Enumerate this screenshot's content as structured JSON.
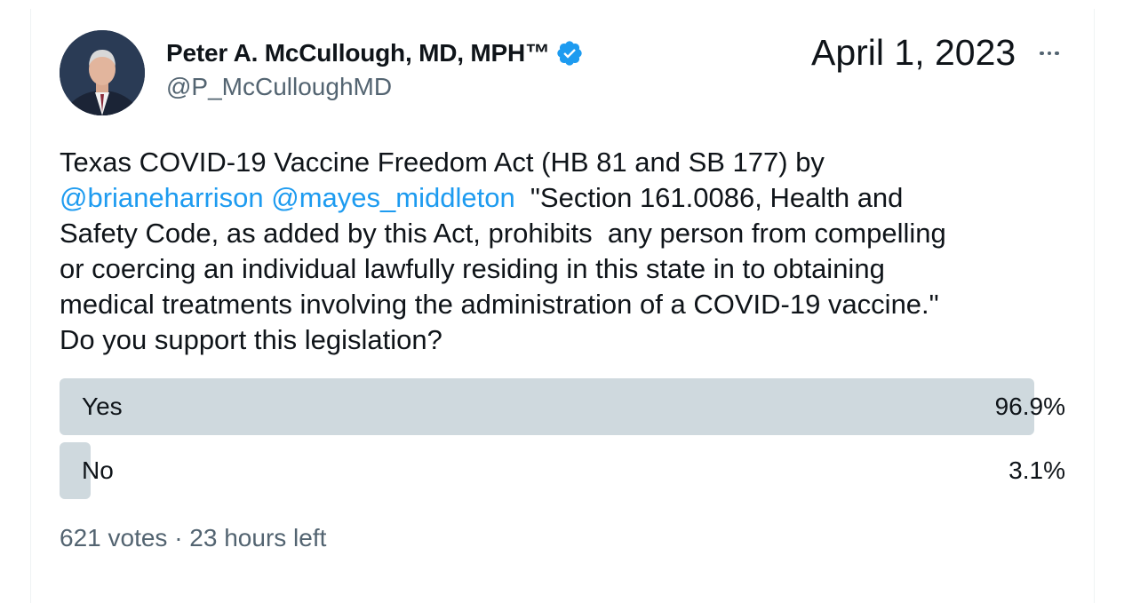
{
  "author": {
    "name": "Peter A. McCullough, MD, MPH™",
    "handle": "@P_McCulloughMD",
    "verified_icon": "verified-badge-icon",
    "verified_color": "#1d9bf0"
  },
  "date": "April 1, 2023",
  "more_icon": "more-horizontal-icon",
  "tweet": {
    "lines": [
      [
        {
          "text": "Texas COVID-19 Vaccine Freedom Act (HB 81 and SB 177) by",
          "type": "text"
        }
      ],
      [
        {
          "text": "@brianeharrison",
          "type": "mention"
        },
        {
          "text": " ",
          "type": "text"
        },
        {
          "text": "@mayes_middleton",
          "type": "mention"
        },
        {
          "text": "  \"Section 161.0086, Health and",
          "type": "text"
        }
      ],
      [
        {
          "text": "Safety Code, as added by this Act, prohibits  any person from compelling",
          "type": "text"
        }
      ],
      [
        {
          "text": "or coercing an individual lawfully residing in this state in to obtaining",
          "type": "text"
        }
      ],
      [
        {
          "text": "medical treatments involving the administration of a COVID-19 vaccine.\"",
          "type": "text"
        }
      ],
      [
        {
          "text": "Do you support this legislation?",
          "type": "text"
        }
      ]
    ]
  },
  "poll": {
    "options": [
      {
        "label": "Yes",
        "percent_text": "96.9%",
        "fraction": 0.969
      },
      {
        "label": "No",
        "percent_text": "3.1%",
        "fraction": 0.031
      }
    ],
    "footer": "621 votes · 23 hours left",
    "bar_color": "#cfd9de"
  },
  "colors": {
    "text": "#0f1419",
    "secondary": "#536471",
    "link": "#1d9bf0"
  }
}
